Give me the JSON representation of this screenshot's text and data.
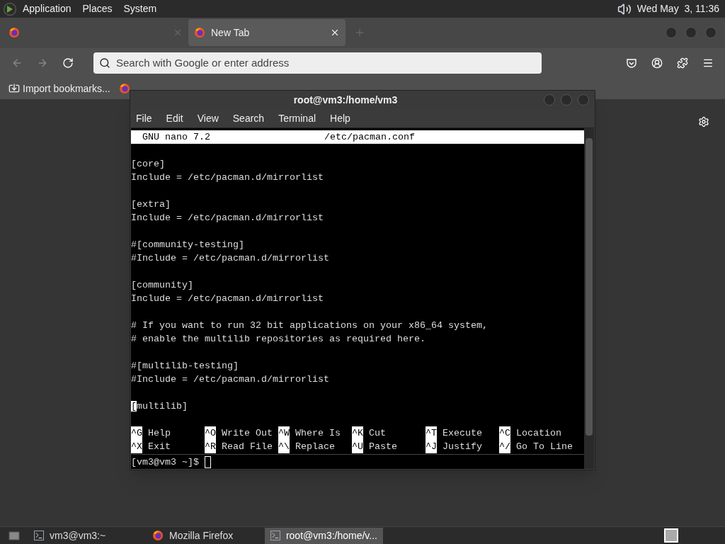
{
  "top_panel": {
    "menus": [
      "Application",
      "Places",
      "System"
    ],
    "clock": "Wed May  3, 11:36"
  },
  "browser": {
    "tabs": [
      {
        "selected": false
      },
      {
        "label": "New Tab",
        "selected": true
      }
    ],
    "address_placeholder": "Search with Google or enter address",
    "bookmarks": [
      {
        "kind": "import",
        "label": "Import bookmarks..."
      },
      {
        "kind": "site"
      }
    ]
  },
  "terminal": {
    "title": "root@vm3:/home/vm3",
    "menu": [
      "File",
      "Edit",
      "View",
      "Search",
      "Terminal",
      "Help"
    ],
    "nano_header": {
      "version": "GNU nano 7.2",
      "file": "/etc/pacman.conf"
    },
    "lines": [
      {
        "kind": "blank"
      },
      {
        "kind": "text",
        "text": "[core]",
        "cursor": false
      },
      {
        "kind": "text",
        "text": "Include = /etc/pacman.d/mirrorlist",
        "cursor": false
      },
      {
        "kind": "blank"
      },
      {
        "kind": "text",
        "text": "[extra]",
        "cursor": false
      },
      {
        "kind": "text",
        "text": "Include = /etc/pacman.d/mirrorlist",
        "cursor": false
      },
      {
        "kind": "blank"
      },
      {
        "kind": "text",
        "text": "#[community-testing]",
        "cursor": false
      },
      {
        "kind": "text",
        "text": "#Include = /etc/pacman.d/mirrorlist",
        "cursor": false
      },
      {
        "kind": "blank"
      },
      {
        "kind": "text",
        "text": "[community]",
        "cursor": false
      },
      {
        "kind": "text",
        "text": "Include = /etc/pacman.d/mirrorlist",
        "cursor": false
      },
      {
        "kind": "blank"
      },
      {
        "kind": "text",
        "text": "# If you want to run 32 bit applications on your x86_64 system,",
        "cursor": false
      },
      {
        "kind": "text",
        "text": "# enable the multilib repositories as required here.",
        "cursor": false
      },
      {
        "kind": "blank"
      },
      {
        "kind": "text",
        "text": "#[multilib-testing]",
        "cursor": false
      },
      {
        "kind": "text",
        "text": "#Include = /etc/pacman.d/mirrorlist",
        "cursor": false
      },
      {
        "kind": "blank"
      },
      {
        "kind": "text",
        "text": "[multilib]",
        "cursor": true
      },
      {
        "kind": "blank"
      }
    ],
    "shortcuts": [
      [
        {
          "key": "^G",
          "label": "Help"
        },
        {
          "key": "^O",
          "label": "Write Out"
        },
        {
          "key": "^W",
          "label": "Where Is"
        },
        {
          "key": "^K",
          "label": "Cut"
        },
        {
          "key": "^T",
          "label": "Execute"
        },
        {
          "key": "^C",
          "label": "Location"
        }
      ],
      [
        {
          "key": "^X",
          "label": "Exit"
        },
        {
          "key": "^R",
          "label": "Read File"
        },
        {
          "key": "^\\",
          "label": "Replace"
        },
        {
          "key": "^U",
          "label": "Paste"
        },
        {
          "key": "^J",
          "label": "Justify"
        },
        {
          "key": "^/",
          "label": "Go To Line"
        }
      ]
    ],
    "prompt": "[vm3@vm3 ~]$"
  },
  "taskbar": [
    {
      "kind": "terminal",
      "label": "vm3@vm3:~",
      "selected": false
    },
    {
      "kind": "firefox",
      "label": "Mozilla Firefox",
      "selected": false
    },
    {
      "kind": "terminal",
      "label": "root@vm3:/home/v...",
      "selected": true
    }
  ]
}
